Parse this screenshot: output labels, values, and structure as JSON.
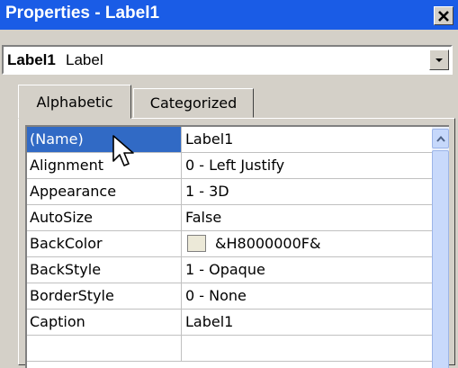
{
  "window": {
    "title": "Properties - Label1"
  },
  "object_selector": {
    "name": "Label1",
    "type": "Label"
  },
  "tabs": [
    {
      "label": "Alphabetic"
    },
    {
      "label": "Categorized"
    }
  ],
  "properties": [
    {
      "name": "(Name)",
      "value": "Label1"
    },
    {
      "name": "Alignment",
      "value": "0 - Left Justify"
    },
    {
      "name": "Appearance",
      "value": "1 - 3D"
    },
    {
      "name": "AutoSize",
      "value": "False"
    },
    {
      "name": "BackColor",
      "value": "&H8000000F&"
    },
    {
      "name": "BackStyle",
      "value": "1 - Opaque"
    },
    {
      "name": "BorderStyle",
      "value": "0 - None"
    },
    {
      "name": "Caption",
      "value": "Label1"
    }
  ],
  "colors": {
    "titlebar": "#1a5ce6",
    "selection": "#316ac5",
    "backcolor_swatch": "#ece9d8"
  },
  "icons": {
    "close": "close-icon",
    "dropdown": "chevron-down-icon",
    "scroll_up": "chevron-up-icon",
    "cursor": "mouse-pointer-icon"
  }
}
